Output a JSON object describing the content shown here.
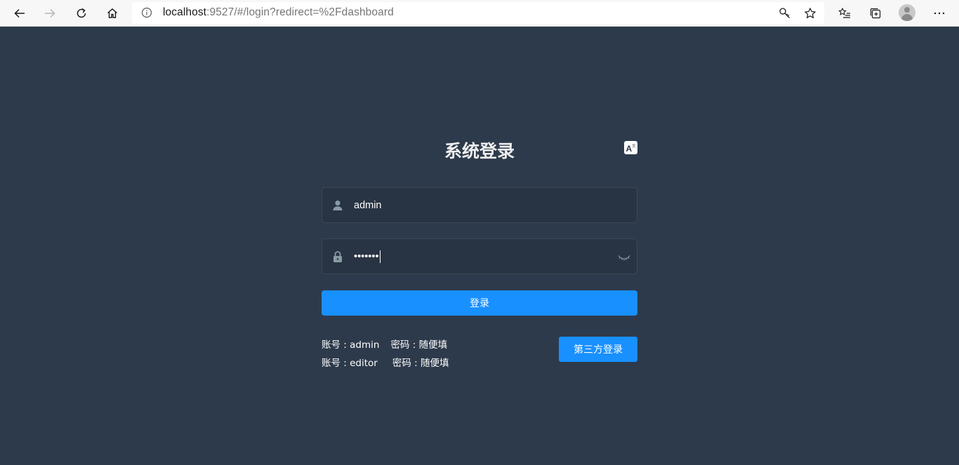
{
  "browser": {
    "url_host": "localhost",
    "url_rest": ":9527/#/login?redirect=%2Fdashboard"
  },
  "login": {
    "title": "系统登录",
    "username_value": "admin",
    "password_value": "•••••••",
    "submit_label": "登录",
    "third_party_label": "第三方登录",
    "tips": [
      {
        "account_label": "账号 : admin",
        "password_label": "密码 : 随便填"
      },
      {
        "account_label": "账号 : editor",
        "password_label": "密码 : 随便填"
      }
    ]
  },
  "icons": {
    "lang": "translate-icon",
    "user": "user-icon",
    "lock": "lock-icon",
    "eye": "eye-closed-icon"
  },
  "colors": {
    "background": "#2d3a4b",
    "primary": "#1890ff",
    "title": "#eeeeee"
  }
}
